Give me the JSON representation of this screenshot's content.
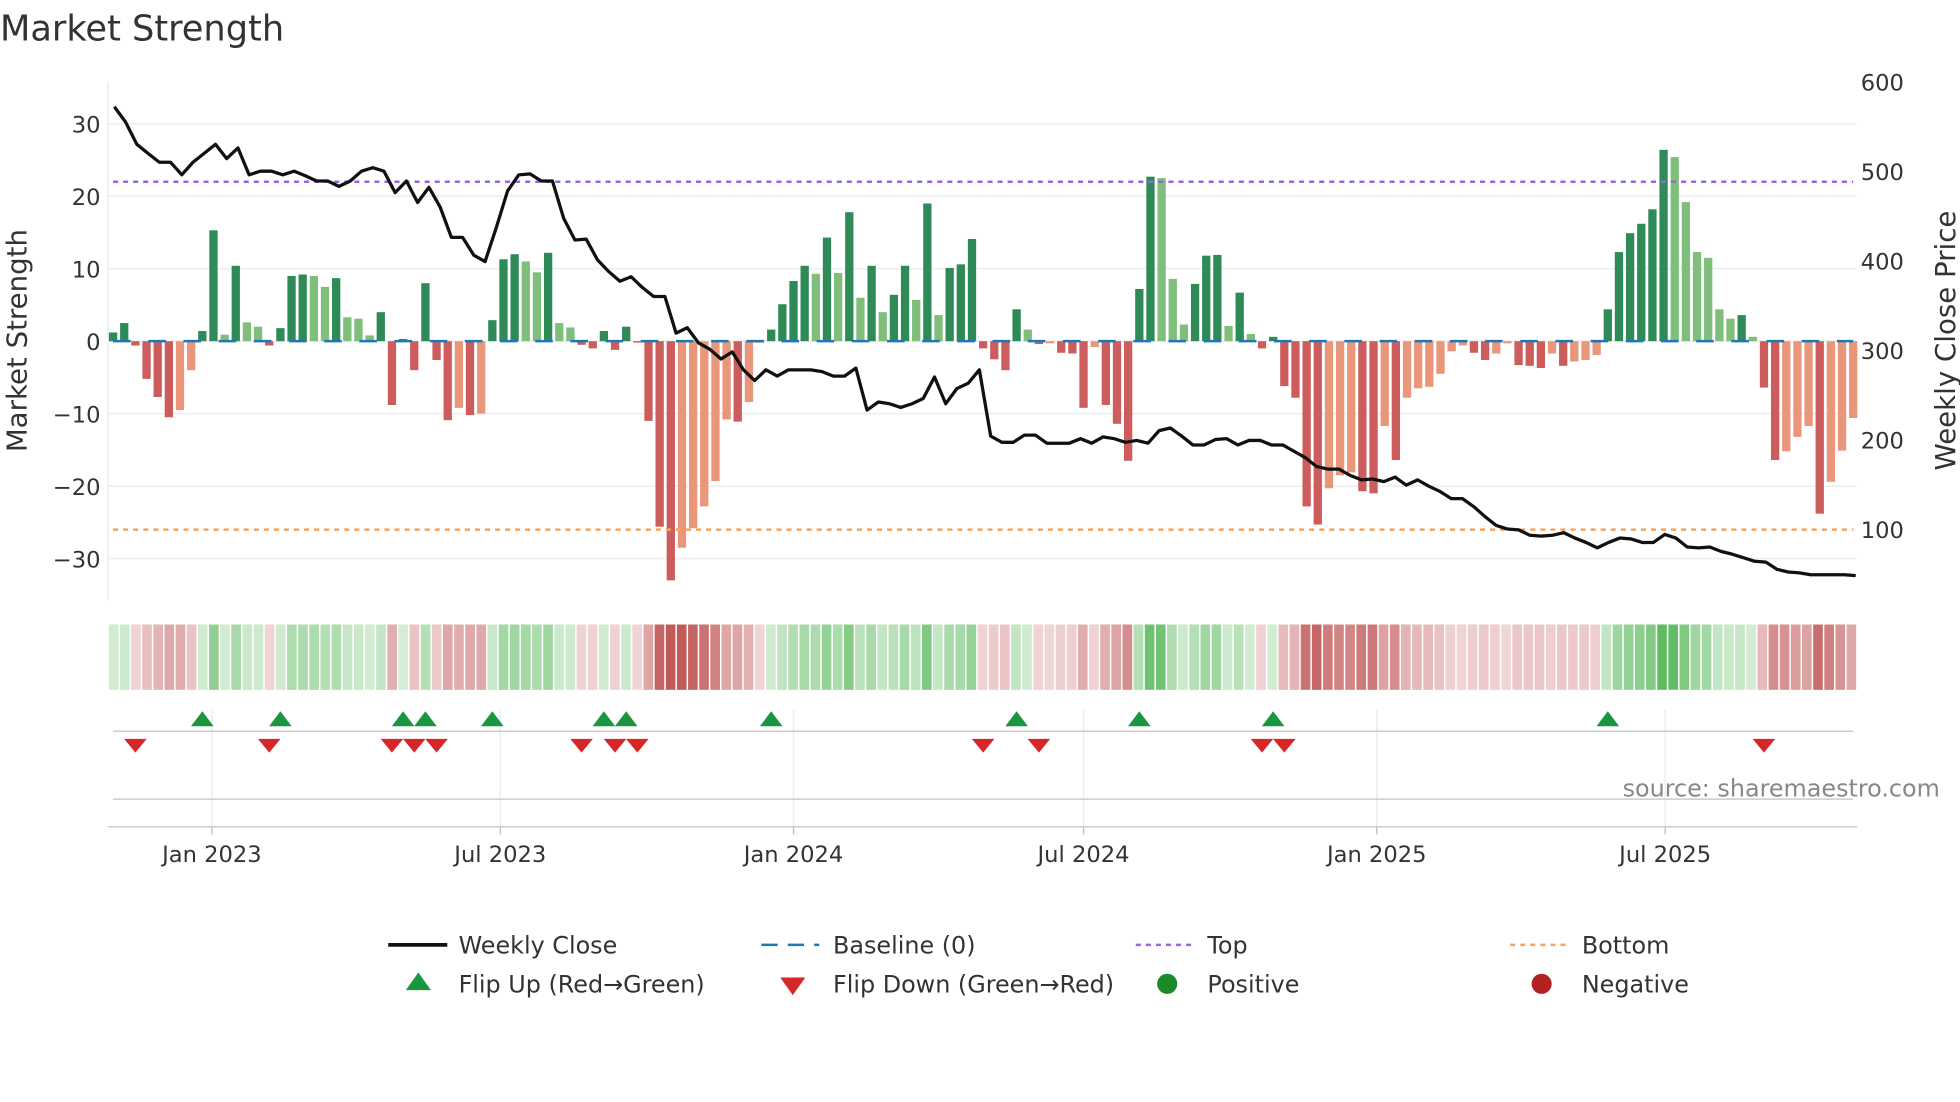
{
  "chart_data": {
    "type": "bar",
    "title": "Market Strength",
    "start_date": "2022-10-31",
    "frequency": "weekly",
    "strength": [
      1.2,
      2.5,
      -0.6,
      -5.2,
      -7.7,
      -10.5,
      -9.5,
      -4,
      1.4,
      15.3,
      0.9,
      10.4,
      2.6,
      2,
      -0.6,
      1.8,
      9,
      9.2,
      9,
      7.5,
      8.7,
      3.3,
      3.1,
      0.8,
      4,
      -8.8,
      0.3,
      -4,
      8,
      -2.6,
      -10.9,
      -9.2,
      -10.2,
      -10,
      2.9,
      11.3,
      12,
      11,
      9.5,
      12.2,
      2.5,
      1.9,
      -0.5,
      -1,
      1.4,
      -1.2,
      2,
      -0.2,
      -11,
      -25.6,
      -33,
      -28.5,
      -25.8,
      -22.8,
      -19.3,
      -10.8,
      -11.1,
      -8.4,
      -0.2,
      1.6,
      5.1,
      8.3,
      10.4,
      9.3,
      14.3,
      9.4,
      17.8,
      6,
      10.4,
      4,
      6.4,
      10.4,
      5.7,
      19,
      3.6,
      10.1,
      10.6,
      14.1,
      -1,
      -2.5,
      -4,
      4.4,
      1.6,
      -0.4,
      -0.3,
      -1.6,
      -1.7,
      -9.2,
      -0.8,
      -8.8,
      -11.4,
      -16.5,
      7.2,
      22.7,
      22.5,
      8.6,
      2.3,
      7.9,
      11.8,
      11.9,
      2.1,
      6.7,
      1,
      -1,
      0.6,
      -6.2,
      -7.8,
      -22.8,
      -25.3,
      -20.3,
      -18.5,
      -18.1,
      -20.7,
      -21,
      -11.7,
      -16.4,
      -7.8,
      -6.5,
      -6.3,
      -4.5,
      -1.4,
      -0.6,
      -1.6,
      -2.6,
      -1.7,
      -0.3,
      -3.3,
      -3.4,
      -3.7,
      -1.7,
      -3.4,
      -2.8,
      -2.6,
      -1.9,
      4.4,
      12.3,
      14.9,
      16.2,
      18.2,
      26.4,
      25.4,
      19.2,
      12.3,
      11.5,
      4.4,
      3.1,
      3.6,
      0.6,
      -6.4,
      -16.4,
      -15.2,
      -13.2,
      -11.7,
      -23.8,
      -19.4,
      -15.1,
      -10.6
    ],
    "weekly_close": [
      572,
      555,
      530,
      520,
      510,
      510,
      496,
      510,
      520,
      530,
      514,
      526,
      496,
      500,
      500,
      496,
      500,
      495,
      489,
      489,
      483,
      489,
      500,
      504,
      500,
      476,
      489,
      465,
      482,
      460,
      426,
      426,
      406,
      399,
      437,
      478,
      496,
      497,
      489,
      489,
      447,
      423,
      424,
      401,
      388,
      377,
      382,
      370,
      360,
      360,
      319,
      325,
      308,
      301,
      290,
      298,
      278,
      266,
      278,
      271,
      278,
      278,
      278,
      276,
      271,
      271,
      280,
      233,
      242,
      240,
      236,
      240,
      246,
      270,
      240,
      257,
      263,
      278,
      204,
      197,
      197,
      205,
      205,
      196,
      196,
      196,
      201,
      196,
      203,
      201,
      197,
      199,
      196,
      210,
      213,
      204,
      194,
      194,
      200,
      201,
      194,
      199,
      199,
      194,
      194,
      187,
      180,
      170,
      167,
      167,
      160,
      155,
      156,
      153,
      158,
      149,
      155,
      148,
      142,
      134,
      134,
      125,
      114,
      104,
      100,
      99,
      93,
      92,
      93,
      96,
      90,
      85,
      79,
      85,
      90,
      89,
      85,
      85,
      94,
      90,
      80,
      79,
      80,
      75,
      72,
      68,
      64,
      63,
      55,
      52,
      51,
      49,
      49,
      49,
      49,
      48
    ],
    "top_level": 22,
    "bottom_level": -26,
    "baseline": 0,
    "flip_up_weeks": [
      8,
      15,
      26,
      28,
      34,
      44,
      46,
      59,
      81,
      92,
      104,
      134
    ],
    "flip_down_weeks": [
      2,
      14,
      25,
      27,
      29,
      42,
      45,
      47,
      78,
      83,
      103,
      105,
      148
    ],
    "left_axis": {
      "label": "Market Strength",
      "range": [
        -35.8,
        35.8
      ],
      "ticks": [
        30,
        20,
        10,
        0,
        -10,
        -20,
        -30
      ],
      "tick_labels": [
        "30",
        "20",
        "10",
        "0",
        "−10",
        "−20",
        "−30"
      ]
    },
    "right_axis": {
      "label": "Weekly Close Price",
      "range": [
        20,
        600
      ],
      "ticks": [
        600,
        500,
        400,
        300,
        200,
        100
      ],
      "tick_labels": [
        "600",
        "500",
        "400",
        "300",
        "200",
        "100"
      ]
    },
    "x_ticks": [
      {
        "date": "2023-01-01",
        "label": "Jan 2023"
      },
      {
        "date": "2023-07-01",
        "label": "Jul 2023"
      },
      {
        "date": "2024-01-01",
        "label": "Jan 2024"
      },
      {
        "date": "2024-07-01",
        "label": "Jul 2024"
      },
      {
        "date": "2025-01-01",
        "label": "Jan 2025"
      },
      {
        "date": "2025-07-01",
        "label": "Jul 2025"
      }
    ],
    "colors": {
      "pos_strong": "#2e8b57",
      "pos_weak": "#7fbf7b",
      "neg_strong": "#cd5c5c",
      "neg_weak": "#e9967a",
      "close": "#111111",
      "baseline": "#1f77b4",
      "top": "#9966dd",
      "bottom": "#f4a460",
      "flip_up": "#1a9641",
      "flip_down": "#d62728",
      "positive": "#1a8a2a",
      "negative": "#b22222"
    },
    "legend": {
      "weekly_close": "Weekly Close",
      "baseline": "Baseline (0)",
      "top": "Top",
      "bottom": "Bottom",
      "flip_up": "Flip Up (Red→Green)",
      "flip_down": "Flip Down (Green→Red)",
      "positive": "Positive",
      "negative": "Negative"
    },
    "source": "source: sharemaestro.com"
  }
}
